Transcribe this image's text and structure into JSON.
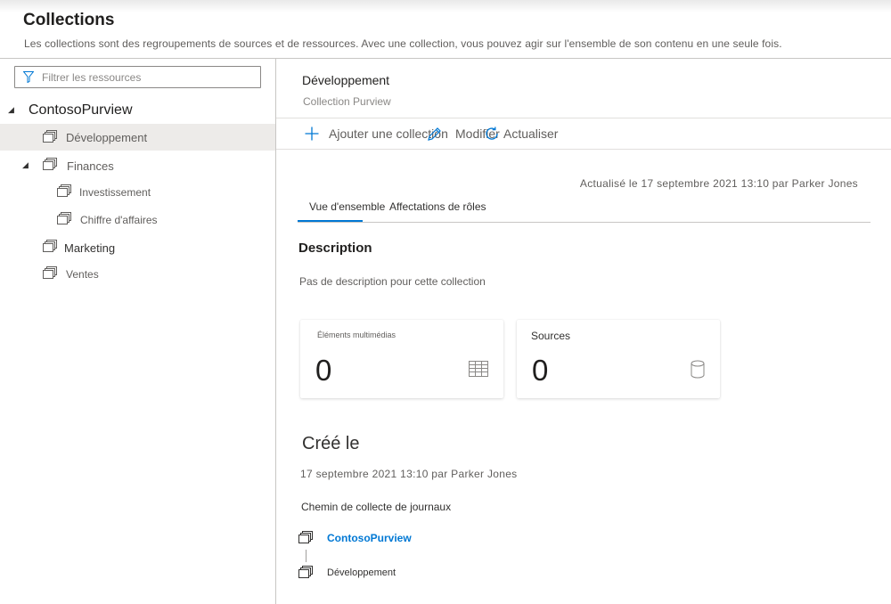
{
  "header": {
    "title": "Collections",
    "subtitle": "Les collections sont des regroupements de sources et de ressources. Avec une collection, vous pouvez agir sur l'ensemble de son contenu en une seule fois."
  },
  "sidebar": {
    "filter_placeholder": "Filtrer les ressources",
    "root": "ContosoPurview",
    "items": [
      {
        "label": "Développement",
        "selected": true,
        "icon": "collection-icon"
      },
      {
        "label": "Finances",
        "expanded": true,
        "icon": "collection-icon"
      },
      {
        "label": "Investissement",
        "icon": "collection-icon"
      },
      {
        "label": "Chiffre d'affaires",
        "icon": "collection-icon"
      },
      {
        "label": "Marketing",
        "icon": "collection-icon"
      },
      {
        "label": "Ventes",
        "icon": "collection-icon"
      }
    ]
  },
  "detail": {
    "name": "Développement",
    "type": "Collection Purview",
    "toolbar": {
      "add": "Ajouter une collection",
      "edit": "Modifier",
      "refresh": "Actualiser"
    },
    "updated": "Actualisé le 17 septembre 2021 13:10 par Parker Jones",
    "tabs": [
      "Vue d'ensemble",
      "Affectations de rôles"
    ],
    "description_title": "Description",
    "description_text": "Pas de description pour cette collection",
    "cards": [
      {
        "label": "Éléments multimédias",
        "value": "0",
        "icon": "table-icon"
      },
      {
        "label": "Sources",
        "value": "0",
        "icon": "database-icon"
      }
    ],
    "created_title": "Créé le",
    "created_text": "17 septembre 2021 13:10 par Parker Jones",
    "path_title": "Chemin de collecte de journaux",
    "path": [
      "ContosoPurview",
      "Développement"
    ]
  },
  "colors": {
    "accent": "#0078d4",
    "selected_bg": "#edebe9",
    "border": "#c8c6c4"
  }
}
